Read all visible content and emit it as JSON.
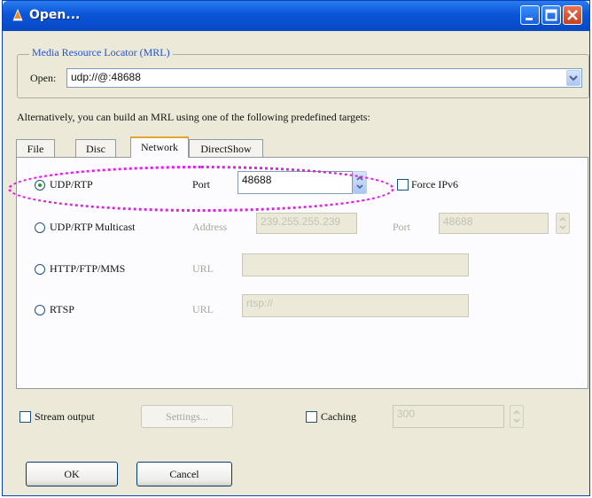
{
  "window": {
    "title": "Open...",
    "controls": {
      "minimize": "minimize-icon",
      "maximize": "maximize-icon",
      "close": "close-icon"
    }
  },
  "mrl": {
    "group_label": "Media Resource Locator (MRL)",
    "open_label": "Open:",
    "open_value": "udp://@:48688"
  },
  "hint": "Alternatively, you can build an MRL using one of the following predefined targets:",
  "tabs": [
    {
      "label": "File"
    },
    {
      "label": "Disc"
    },
    {
      "label": "Network"
    },
    {
      "label": "DirectShow"
    }
  ],
  "network": {
    "udp": {
      "label": "UDP/RTP",
      "port_label": "Port",
      "port_value": "48688",
      "selected": true
    },
    "force_ipv6": {
      "label": "Force IPv6"
    },
    "multicast": {
      "label": "UDP/RTP Multicast",
      "address_label": "Address",
      "address_value": "239.255.255.239",
      "port_label": "Port",
      "port_value": "48688"
    },
    "http": {
      "label": "HTTP/FTP/MMS",
      "url_label": "URL",
      "url_value": ""
    },
    "rtsp": {
      "label": "RTSP",
      "url_label": "URL",
      "url_value": "rtsp://"
    }
  },
  "bottom": {
    "stream_output": "Stream output",
    "settings": "Settings...",
    "caching": "Caching",
    "caching_value": "300"
  },
  "buttons": {
    "ok": "OK",
    "cancel": "Cancel"
  },
  "colors": {
    "titlebar": "#0a55d8",
    "highlight": "#e31ce6",
    "radio_dot": "#21a121"
  }
}
